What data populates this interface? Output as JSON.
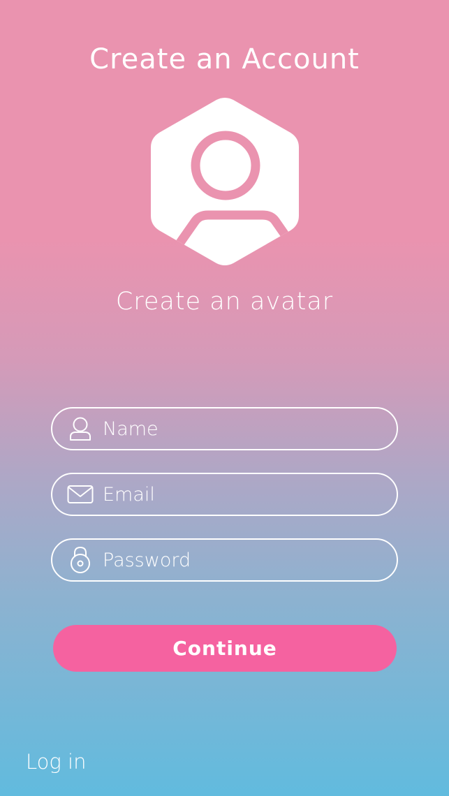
{
  "header": {
    "title": "Create an Account"
  },
  "avatar": {
    "icon": "user-avatar-hexagon-icon",
    "label": "Create an avatar"
  },
  "form": {
    "name_placeholder": "Name",
    "email_placeholder": "Email",
    "password_placeholder": "Password",
    "name_icon": "user-icon",
    "email_icon": "envelope-icon",
    "password_icon": "lock-icon"
  },
  "actions": {
    "continue_label": "Continue",
    "login_label": "Log in"
  },
  "colors": {
    "gradient_top": "#EA93AF",
    "gradient_bottom": "#61BBDE",
    "button": "#F562A0",
    "text": "#FFFFFF"
  }
}
